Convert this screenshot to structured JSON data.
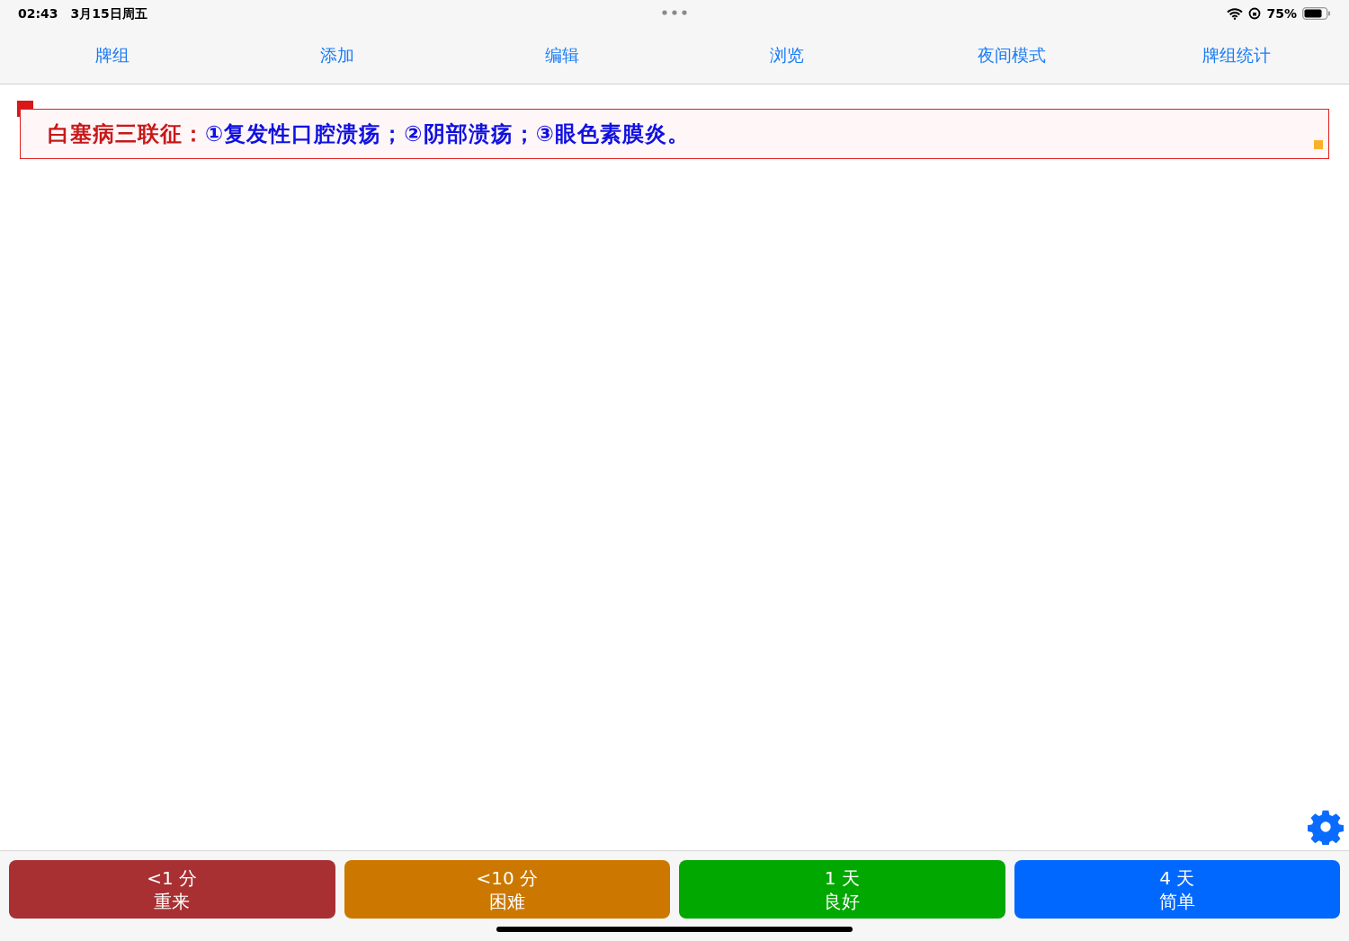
{
  "status_bar": {
    "time": "02:43",
    "date": "3月15日周五",
    "battery": "75%"
  },
  "toolbar": [
    {
      "label": "牌组"
    },
    {
      "label": "添加"
    },
    {
      "label": "编辑"
    },
    {
      "label": "浏览"
    },
    {
      "label": "夜间模式"
    },
    {
      "label": "牌组统计"
    }
  ],
  "card": {
    "label": "白塞病三联征：",
    "content": "①复发性口腔溃疡；②阴部溃疡；③眼色素膜炎。"
  },
  "answer_buttons": [
    {
      "interval": "<1 分",
      "label": "重来",
      "color": "#a83032"
    },
    {
      "interval": "<10 分",
      "label": "困难",
      "color": "#cc7800"
    },
    {
      "interval": "1 天",
      "label": "良好",
      "color": "#00a800"
    },
    {
      "interval": "4 天",
      "label": "简单",
      "color": "#0068ff"
    }
  ]
}
